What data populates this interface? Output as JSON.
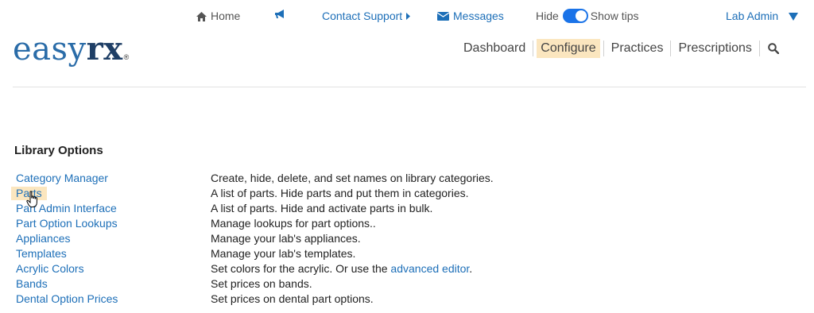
{
  "topbar": {
    "home_label": "Home",
    "contact_label": "Contact Support",
    "messages_label": "Messages",
    "hide_label": "Hide",
    "show_tips_label": "Show tips",
    "user_label": "Lab Admin"
  },
  "logo": {
    "part1": "easy",
    "part2": "rx",
    "reg": "®"
  },
  "nav": {
    "items": [
      {
        "label": "Dashboard"
      },
      {
        "label": "Configure"
      },
      {
        "label": "Practices"
      },
      {
        "label": "Prescriptions"
      }
    ],
    "active": "Configure"
  },
  "section": {
    "title": "Library Options"
  },
  "options": [
    {
      "name": "Category Manager",
      "desc": "Create, hide, delete, and set names on library categories."
    },
    {
      "name": "Parts",
      "desc": "A list of parts. Hide parts and put them in categories."
    },
    {
      "name": "Part Admin Interface",
      "desc": "A list of parts. Hide and activate parts in bulk."
    },
    {
      "name": "Part Option Lookups",
      "desc": "Manage lookups for part options.."
    },
    {
      "name": "Appliances",
      "desc": "Manage your lab's appliances."
    },
    {
      "name": "Templates",
      "desc": "Manage your lab's templates."
    },
    {
      "name": "Acrylic Colors",
      "desc": "Set colors for the acrylic. Or use the ",
      "link": "advanced editor",
      "desc_end": "."
    },
    {
      "name": "Bands",
      "desc": "Set prices on bands."
    },
    {
      "name": "Dental Option Prices",
      "desc": "Set prices on dental part options."
    }
  ],
  "colors": {
    "link": "#1d6fb8",
    "highlight": "#fbe6bf",
    "toggle": "#1a73e8",
    "logo": "#2a6ca8"
  }
}
